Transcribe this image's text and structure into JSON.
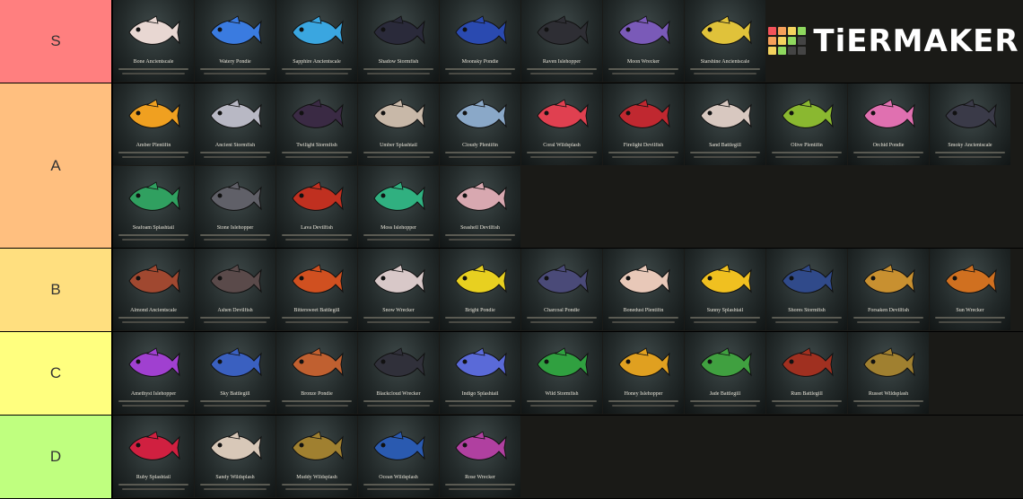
{
  "app": {
    "logo_text": "TiERMAKER"
  },
  "logo_colors": [
    "#f4525a",
    "#f6a05a",
    "#f4d35e",
    "#8ed85e",
    "#f6a05a",
    "#f4d35e",
    "#8ed85e",
    "#444",
    "#f4d35e",
    "#8ed85e",
    "#444",
    "#444"
  ],
  "tiers": [
    {
      "label": "S",
      "color": "#ff7f7f",
      "items": [
        {
          "name": "Bone Ancientscale",
          "fish": "#e8d7d2"
        },
        {
          "name": "Watery Pondie",
          "fish": "#3a7be0"
        },
        {
          "name": "Sapphire Ancientscale",
          "fish": "#3aa6e0"
        },
        {
          "name": "Shadow Stormfish",
          "fish": "#2a2a3a"
        },
        {
          "name": "Moonsky Pondie",
          "fish": "#2a4ab0"
        },
        {
          "name": "Raven Islehopper",
          "fish": "#2e2e34"
        },
        {
          "name": "Moon Wrecker",
          "fish": "#7a5ab8"
        },
        {
          "name": "Starshine Ancientscale",
          "fish": "#e0c23a"
        }
      ]
    },
    {
      "label": "A",
      "color": "#ffbf7f",
      "items": [
        {
          "name": "Amber Plentifin",
          "fish": "#f0a020"
        },
        {
          "name": "Ancient Stormfish",
          "fish": "#b8b8c4"
        },
        {
          "name": "Twilight Stormfish",
          "fish": "#3a2a44"
        },
        {
          "name": "Umber Splashtail",
          "fish": "#c8b8a8"
        },
        {
          "name": "Cloudy Plentifin",
          "fish": "#8aa8c8"
        },
        {
          "name": "Coral Wildsplash",
          "fish": "#e04050"
        },
        {
          "name": "Firelight Devilfish",
          "fish": "#c02830"
        },
        {
          "name": "Sand Battlegill",
          "fish": "#d8c8c0"
        },
        {
          "name": "Olive Plentifin",
          "fish": "#8ab830"
        },
        {
          "name": "Orchid Pondie",
          "fish": "#e070b0"
        },
        {
          "name": "Smoky Ancientscale",
          "fish": "#3a3a48"
        },
        {
          "name": "Seafoam Splashtail",
          "fish": "#30a060"
        },
        {
          "name": "Stone Islehopper",
          "fish": "#606068"
        },
        {
          "name": "Lava Devilfish",
          "fish": "#c03020"
        },
        {
          "name": "Moss Islehopper",
          "fish": "#30b080"
        },
        {
          "name": "Seashell Devilfish",
          "fish": "#d8a8b0"
        }
      ]
    },
    {
      "label": "B",
      "color": "#ffdf7f",
      "items": [
        {
          "name": "Almond Ancientscale",
          "fish": "#a04830"
        },
        {
          "name": "Ashen Devilfish",
          "fish": "#5a4a4a"
        },
        {
          "name": "Bittersweet Battlegill",
          "fish": "#d05020"
        },
        {
          "name": "Snow Wrecker",
          "fish": "#d8c8c8"
        },
        {
          "name": "Bright Pondie",
          "fish": "#e8d020"
        },
        {
          "name": "Charcoal Pondie",
          "fish": "#4a4a78"
        },
        {
          "name": "Bonedust Plentifin",
          "fish": "#e8c8b8"
        },
        {
          "name": "Sunny Splashtail",
          "fish": "#f0c020"
        },
        {
          "name": "Shores Stormfish",
          "fish": "#304a8a"
        },
        {
          "name": "Forsaken Devilfish",
          "fish": "#c89030"
        },
        {
          "name": "Sun Wrecker",
          "fish": "#d07020"
        }
      ]
    },
    {
      "label": "C",
      "color": "#ffff7f",
      "items": [
        {
          "name": "Amethyst Islehopper",
          "fish": "#a040d0"
        },
        {
          "name": "Sky Battlegill",
          "fish": "#3a60c0"
        },
        {
          "name": "Bronze Pondie",
          "fish": "#c06030"
        },
        {
          "name": "Blackcloud Wrecker",
          "fish": "#30303a"
        },
        {
          "name": "Indigo Splashtail",
          "fish": "#5a6ad8"
        },
        {
          "name": "Wild Stormfish",
          "fish": "#30a040"
        },
        {
          "name": "Honey Islehopper",
          "fish": "#e0a020"
        },
        {
          "name": "Jade Battlegill",
          "fish": "#40a040"
        },
        {
          "name": "Rum Battlegill",
          "fish": "#a03020"
        },
        {
          "name": "Russet Wildsplash",
          "fish": "#a08030"
        }
      ]
    },
    {
      "label": "D",
      "color": "#bfff7f",
      "items": [
        {
          "name": "Ruby Splashtail",
          "fish": "#d02040"
        },
        {
          "name": "Sandy Wildsplash",
          "fish": "#d8c8b8"
        },
        {
          "name": "Muddy Wildsplash",
          "fish": "#a08030"
        },
        {
          "name": "Ocean Wildsplash",
          "fish": "#2a5ab0"
        },
        {
          "name": "Rose Wrecker",
          "fish": "#b040a0"
        }
      ]
    }
  ]
}
